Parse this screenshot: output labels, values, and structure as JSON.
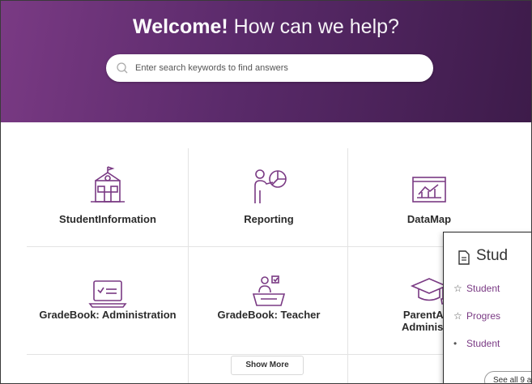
{
  "hero": {
    "title_strong": "Welcome!",
    "title_light": "How can we help?",
    "search_placeholder": "Enter search keywords to find answers"
  },
  "tiles": [
    {
      "label": "StudentInformation",
      "icon": "school-building-icon"
    },
    {
      "label": "Reporting",
      "icon": "presenter-pie-chart-icon"
    },
    {
      "label": "DataMap",
      "icon": "line-chart-board-icon"
    },
    {
      "label": "GradeBook: Administration",
      "icon": "laptop-checklist-icon"
    },
    {
      "label": "GradeBook: Teacher",
      "icon": "teacher-desk-icon"
    },
    {
      "label_line1": "ParentAcc",
      "label_line2": "Administra",
      "icon": "graduation-cap-icon"
    }
  ],
  "show_more_label": "Show More",
  "popup": {
    "title": "Stud",
    "items": [
      {
        "prefix": "☆",
        "text": "Student"
      },
      {
        "prefix": "☆",
        "text": "Progres"
      },
      {
        "prefix": "•",
        "text": "Student"
      }
    ],
    "see_all_label": "See all 9 a"
  },
  "colors": {
    "brand_purple": "#7a3a84",
    "hero_dark": "#3d1b4a"
  }
}
